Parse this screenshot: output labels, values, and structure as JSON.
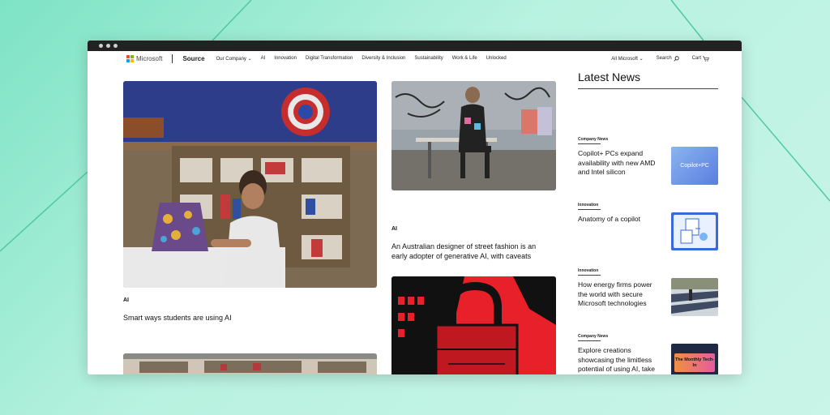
{
  "nav": {
    "brand": "Microsoft",
    "section": "Source",
    "links": [
      "Our Company ⌄",
      "AI",
      "Innovation",
      "Digital Transformation",
      "Diversity & Inclusion",
      "Sustainability",
      "Work & Life",
      "Unlocked"
    ],
    "all_microsoft": "All Microsoft ⌄",
    "search": "Search",
    "cart": "Cart"
  },
  "cards": [
    {
      "tag": "AI",
      "title": "Smart ways students are using AI"
    },
    {
      "tag": "AI",
      "title": "An Australian designer of street fashion is an early adopter of generative AI, with caveats"
    }
  ],
  "sidebar": {
    "heading": "Latest News",
    "items": [
      {
        "tag": "Company News",
        "title": "Copilot+ PCs expand availability with new AMD and Intel silicon",
        "thumb_text": "Copilot+PC"
      },
      {
        "tag": "Innovation",
        "title": "Anatomy of a copilot"
      },
      {
        "tag": "Innovation",
        "title": "How energy firms power the world with secure Microsoft technologies"
      },
      {
        "tag": "Company News",
        "title": "Explore creations showcasing the limitless potential of using AI, take the new AI quiz and more",
        "thumb_text": "The Monthly Tech-In"
      }
    ]
  },
  "colors": {
    "background": "#7de3c4",
    "accent_red": "#e8202a"
  }
}
